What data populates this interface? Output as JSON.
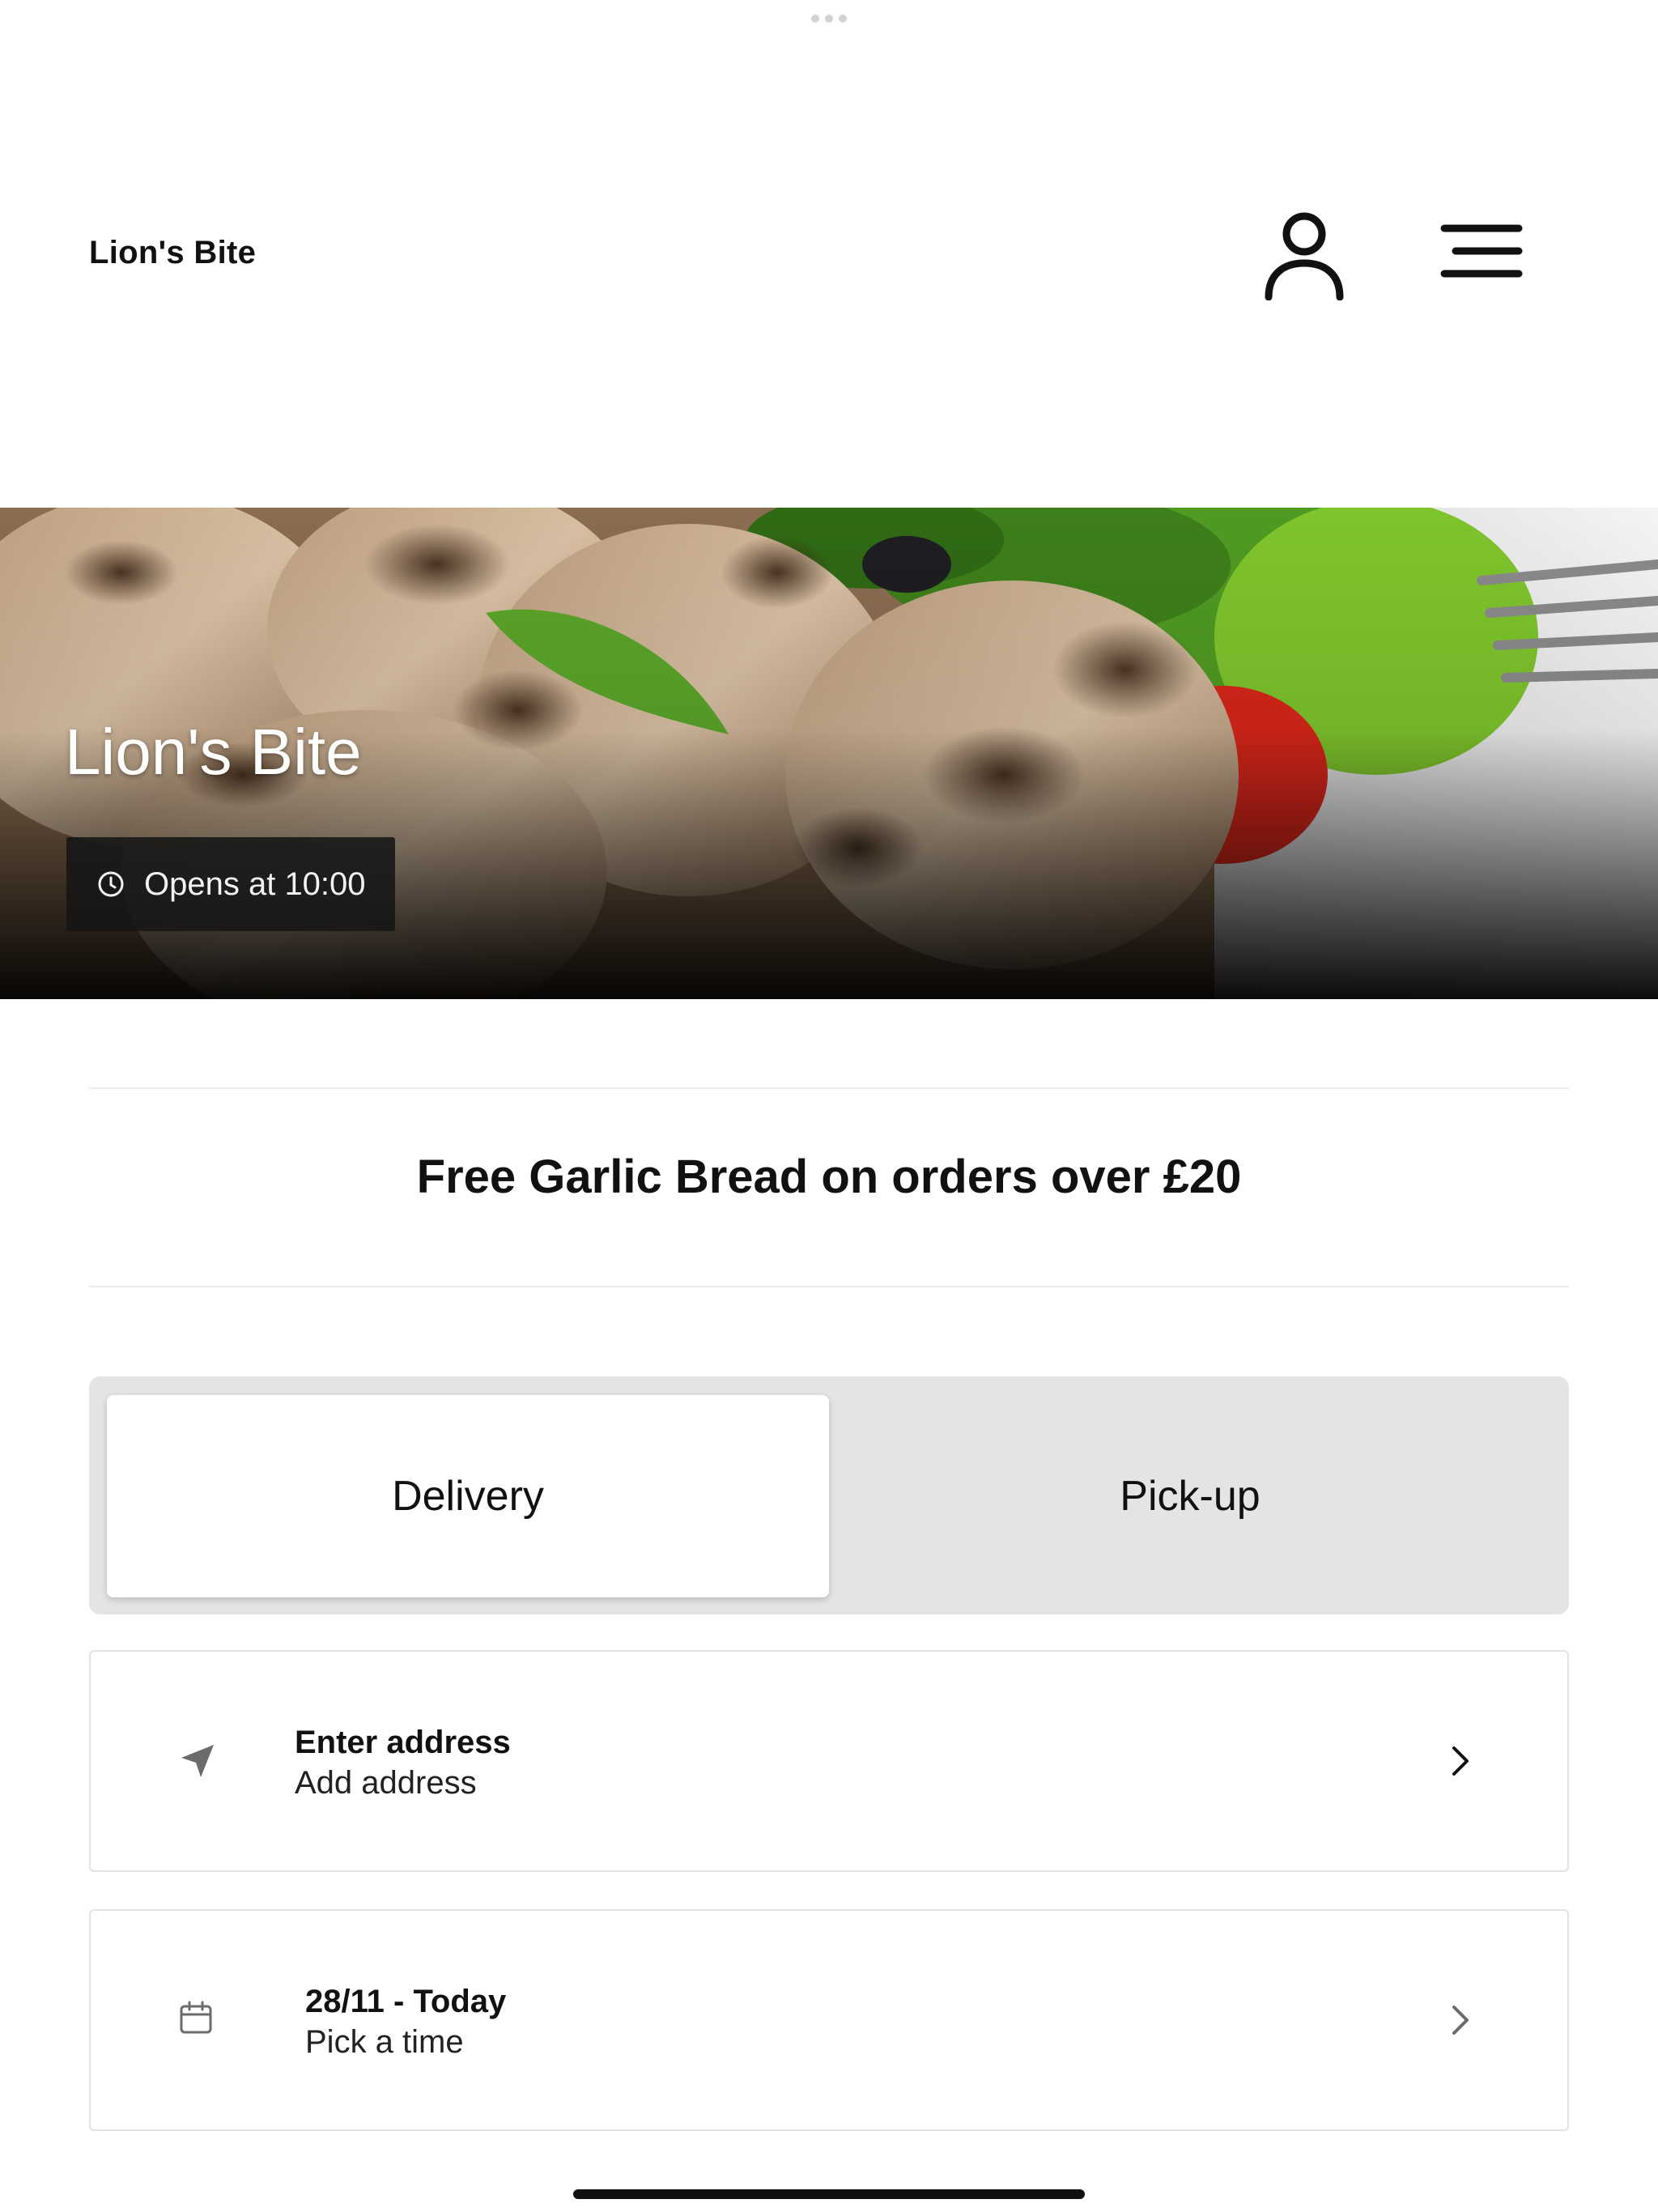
{
  "header": {
    "brand": "Lion's Bite",
    "account_icon": "user-icon",
    "menu_icon": "hamburger-menu-icon"
  },
  "hero": {
    "title": "Lion's Bite",
    "hours_icon": "clock-icon",
    "hours_text": "Opens at 10:00"
  },
  "promo": {
    "text": "Free Garlic Bread on orders over £20"
  },
  "order_mode": {
    "options": [
      {
        "label": "Delivery",
        "selected": true
      },
      {
        "label": "Pick-up",
        "selected": false
      }
    ]
  },
  "address_card": {
    "icon": "location-arrow-icon",
    "title": "Enter address",
    "subtitle": "Add address",
    "chevron": "chevron-right-icon"
  },
  "time_card": {
    "icon": "calendar-icon",
    "title": "28/11 - Today",
    "subtitle": "Pick a time",
    "chevron": "chevron-right-icon"
  },
  "colors": {
    "background": "#ffffff",
    "text": "#111111",
    "segment_bg": "#e4e4e4",
    "card_border": "#e2e2e2",
    "hours_pill_bg": "#161616"
  }
}
